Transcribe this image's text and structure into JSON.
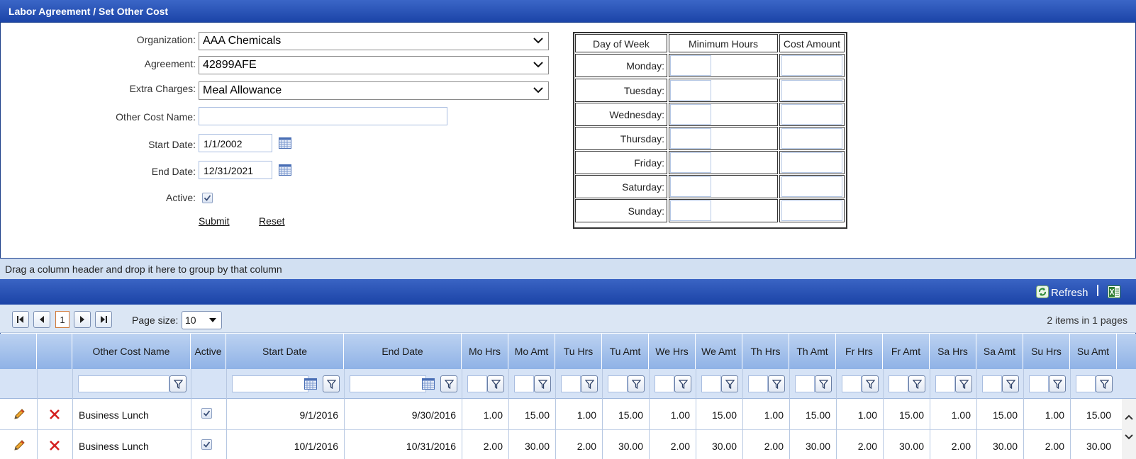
{
  "window": {
    "title": "Labor Agreement / Set Other Cost"
  },
  "form": {
    "organization_label": "Organization:",
    "organization_value": "AAA Chemicals",
    "agreement_label": "Agreement:",
    "agreement_value": "42899AFE",
    "extra_charges_label": "Extra Charges:",
    "extra_charges_value": "Meal Allowance",
    "other_cost_name_label": "Other Cost Name:",
    "other_cost_name_value": "",
    "start_date_label": "Start Date:",
    "start_date_value": "1/1/2002",
    "end_date_label": "End Date:",
    "end_date_value": "12/31/2021",
    "active_label": "Active:",
    "active_checked": true,
    "submit_label": "Submit",
    "reset_label": "Reset"
  },
  "day_table": {
    "headers": [
      "Day of Week",
      "Minimum Hours",
      "Cost Amount"
    ],
    "days": [
      "Monday:",
      "Tuesday:",
      "Wednesday:",
      "Thursday:",
      "Friday:",
      "Saturday:",
      "Sunday:"
    ]
  },
  "grid": {
    "group_hint": "Drag a column header and drop it here to group by that column",
    "refresh_label": "Refresh",
    "current_page": "1",
    "page_size_label": "Page size:",
    "page_size_value": "10",
    "items_info": "2 items in 1 pages",
    "columns": [
      "Other Cost Name",
      "Active",
      "Start Date",
      "End Date",
      "Mo Hrs",
      "Mo Amt",
      "Tu Hrs",
      "Tu Amt",
      "We Hrs",
      "We Amt",
      "Th Hrs",
      "Th Amt",
      "Fr Hrs",
      "Fr Amt",
      "Sa Hrs",
      "Sa Amt",
      "Su Hrs",
      "Su Amt"
    ],
    "rows": [
      {
        "name": "Business Lunch",
        "active": true,
        "start": "9/1/2016",
        "end": "9/30/2016",
        "values": [
          "1.00",
          "15.00",
          "1.00",
          "15.00",
          "1.00",
          "15.00",
          "1.00",
          "15.00",
          "1.00",
          "15.00",
          "1.00",
          "15.00",
          "1.00",
          "15.00"
        ]
      },
      {
        "name": "Business Lunch",
        "active": true,
        "start": "10/1/2016",
        "end": "10/31/2016",
        "values": [
          "2.00",
          "30.00",
          "2.00",
          "30.00",
          "2.00",
          "30.00",
          "2.00",
          "30.00",
          "2.00",
          "30.00",
          "2.00",
          "30.00",
          "2.00",
          "30.00"
        ]
      }
    ]
  },
  "colors": {
    "header_blue": "#1b44a8",
    "grid_header": "#a7c4ec",
    "filter_row": "#d6e3f6"
  }
}
